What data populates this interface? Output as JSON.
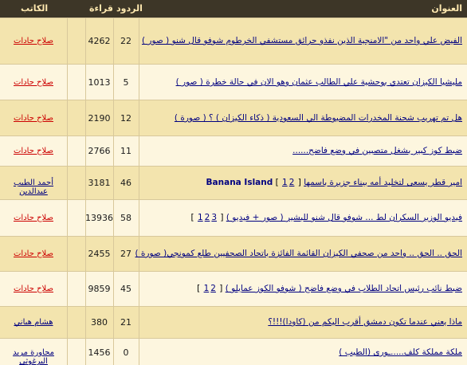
{
  "headers": {
    "title": "العنوان",
    "replies": "الردود",
    "views": "قراءة",
    "author": "الكاتب"
  },
  "rows": [
    {
      "title": "الفيض علي واحد من \"الامنجية الذين نفذو حرائق مستشفي الخرطوم شوفو قال شنو ( صور )",
      "suffix": "",
      "pages": [],
      "replies": "22",
      "views": "4262",
      "author": "صلاح جادات"
    },
    {
      "title": "مليشيا الكيزان تعتدي بوحشية علي الطالب عثمان وهو الان في حالة خطرة ( صور )",
      "suffix": "",
      "pages": [],
      "replies": "5",
      "views": "1013",
      "author": "صلاح جادات"
    },
    {
      "title": "هل تم تهريب شحنة المخدرات المضبوطة الي السعودية ( ذكاء الكيزان ) ؟ ( صورة )",
      "suffix": "",
      "pages": [],
      "replies": "12",
      "views": "2190",
      "author": "صلاح جادات"
    },
    {
      "title": "ضبط كوز كبير بشغل متصبين في وضع فاضح......",
      "suffix": "",
      "pages": [],
      "replies": "11",
      "views": "2766",
      "author": "صلاح جادات"
    },
    {
      "title": "امير قطر يسعى لتخليد أمه ببناء جزيرة باسمها",
      "suffix": "Banana Island",
      "pages": [
        "1",
        "2"
      ],
      "replies": "46",
      "views": "3181",
      "author": "أحمد الطيب عبدالدين"
    },
    {
      "title": "فيديو الوزير السكران لط ... شوفو قال شنو للبشير ( صور + فيديو )",
      "suffix": "",
      "pages": [
        "1",
        "2",
        "3"
      ],
      "replies": "58",
      "views": "13936",
      "author": "صلاح جادات"
    },
    {
      "title": "الحق .. الحق .. واحد من صحفي الكيزان القائمة الفائزة باتحاد الصحفيين طلع كمونجي( صورة )",
      "suffix": "",
      "pages": [],
      "replies": "27",
      "views": "2455",
      "author": "صلاح جادات"
    },
    {
      "title": "ضبط نائب رئيس اتحاد الطلاب في وضع فاضح ( شوفو الكوز عمايلو )",
      "suffix": "",
      "pages": [
        "1",
        "2"
      ],
      "replies": "45",
      "views": "9859",
      "author": "صلاح جادات"
    },
    {
      "title": "ماذا يعني عندما تكون دمشق أقرب اليكم من (كاودا)!!!؟",
      "suffix": "",
      "pages": [],
      "replies": "21",
      "views": "380",
      "author": "هشام هباني"
    },
    {
      "title": "ملكة مملكة كلف.....ـورى (الطيب )",
      "suffix": "",
      "pages": [],
      "replies": "0",
      "views": "1456",
      "author": "مجاورة مريد البرغوثي"
    }
  ],
  "colors": {
    "row_light": "#fdf6df",
    "row_dark": "#f3e4ae",
    "title_link": "#000080",
    "author_red": "#cc0000",
    "author_blue": "#000080"
  }
}
